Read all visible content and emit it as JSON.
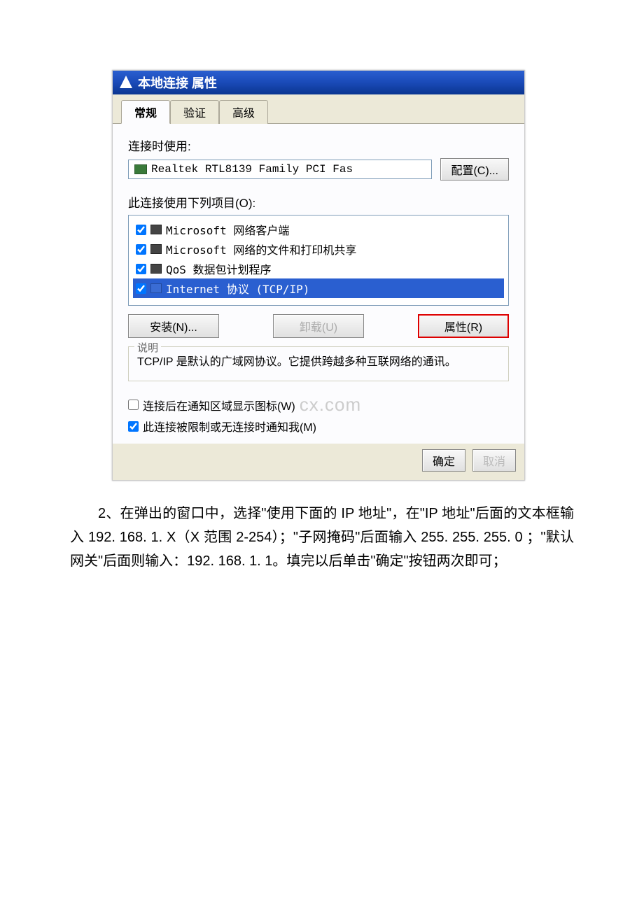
{
  "dialog": {
    "title": "本地连接 属性",
    "tabs": [
      "常规",
      "验证",
      "高级"
    ],
    "active_tab": 0,
    "connect_using_label": "连接时使用:",
    "adapter": "Realtek RTL8139 Family PCI Fas",
    "configure_btn": "配置(C)...",
    "items_label": "此连接使用下列项目(O):",
    "items": [
      {
        "checked": true,
        "label": "Microsoft 网络客户端",
        "selected": false
      },
      {
        "checked": true,
        "label": "Microsoft 网络的文件和打印机共享",
        "selected": false
      },
      {
        "checked": true,
        "label": "QoS 数据包计划程序",
        "selected": false
      },
      {
        "checked": true,
        "label": "Internet 协议 (TCP/IP)",
        "selected": true
      }
    ],
    "install_btn": "安装(N)...",
    "uninstall_btn": "卸载(U)",
    "properties_btn": "属性(R)",
    "group_title": "说明",
    "description": "TCP/IP 是默认的广域网协议。它提供跨越多种互联网络的通讯。",
    "show_icon_checkbox": {
      "checked": false,
      "label": "连接后在通知区域显示图标(W)"
    },
    "notify_checkbox": {
      "checked": true,
      "label": "此连接被限制或无连接时通知我(M)"
    },
    "ok_btn": "确定",
    "cancel_btn": "取消",
    "watermark": "cx.com"
  },
  "paragraph": "2、在弹出的窗口中，选择\"使用下面的 IP 地址\"，在\"IP 地址\"后面的文本框输入 192. 168. 1. X（X 范围 2-254）；\"子网掩码\"后面输入 255. 255. 255. 0 ；\"默认网关\"后面则输入：192. 168. 1. 1。填完以后单击\"确定\"按钮两次即可；"
}
